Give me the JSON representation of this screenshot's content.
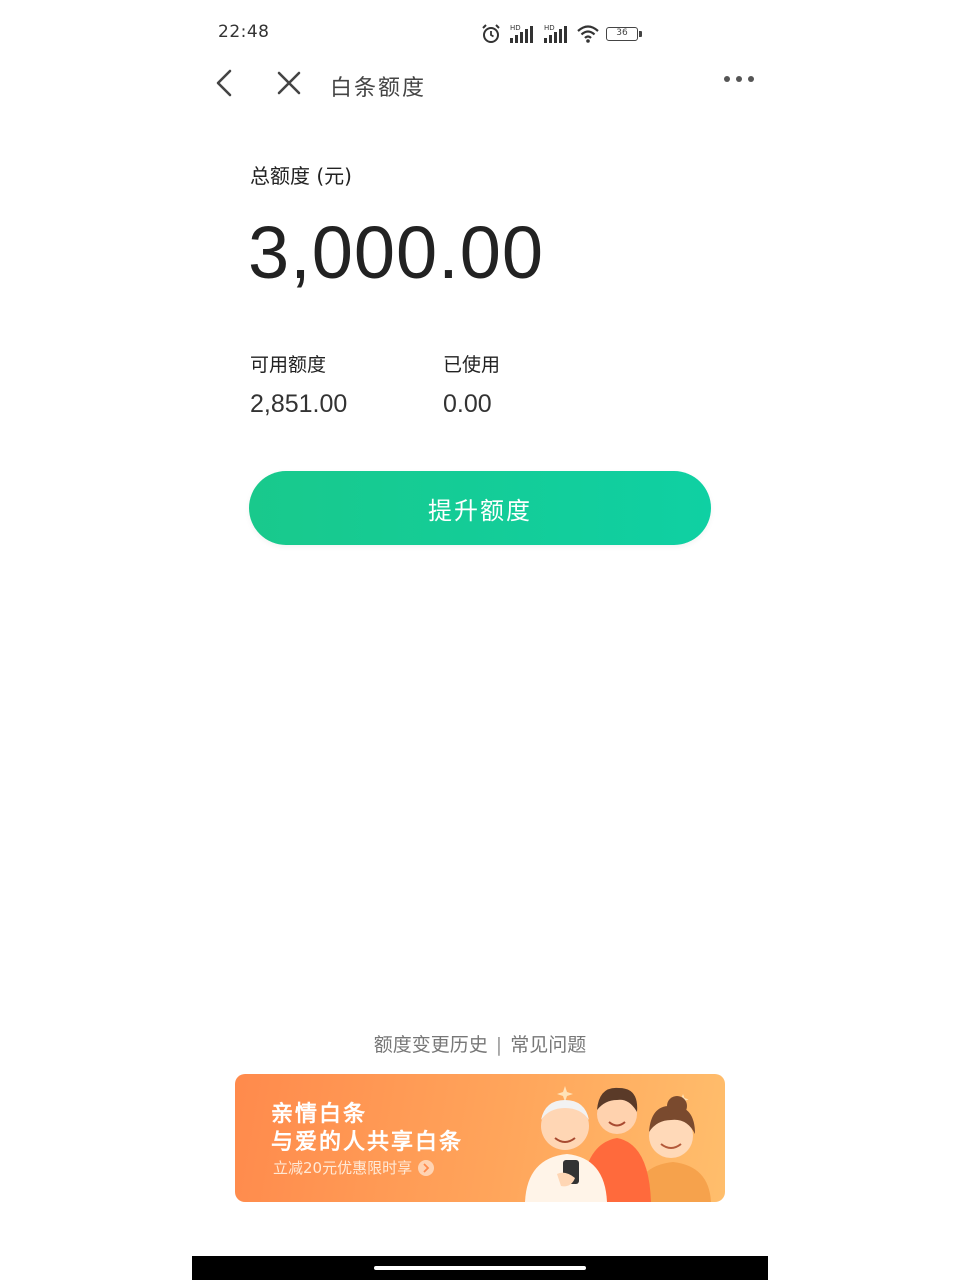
{
  "status_bar": {
    "time": "22:48",
    "battery": "36",
    "icons": [
      "alarm-icon",
      "signal-hd-icon",
      "signal-hd-icon",
      "wifi-icon",
      "battery-icon"
    ]
  },
  "header": {
    "title": "白条额度",
    "icons": [
      "back-icon",
      "close-icon",
      "more-icon"
    ]
  },
  "credit": {
    "total_label": "总额度 (元)",
    "total_amount": "3,000.00",
    "available_label": "可用额度",
    "available_value": "2,851.00",
    "used_label": "已使用",
    "used_value": "0.00"
  },
  "actions": {
    "raise_label": "提升额度"
  },
  "links": {
    "history": "额度变更历史",
    "separator": "|",
    "faq": "常见问题"
  },
  "banner": {
    "title": "亲情白条",
    "subtitle": "与爱的人共享白条",
    "promo": "立减20元优惠限时享",
    "accent_color": "#ff8a4c"
  },
  "colors": {
    "primary_green": "#19c98c",
    "text": "#222222"
  }
}
